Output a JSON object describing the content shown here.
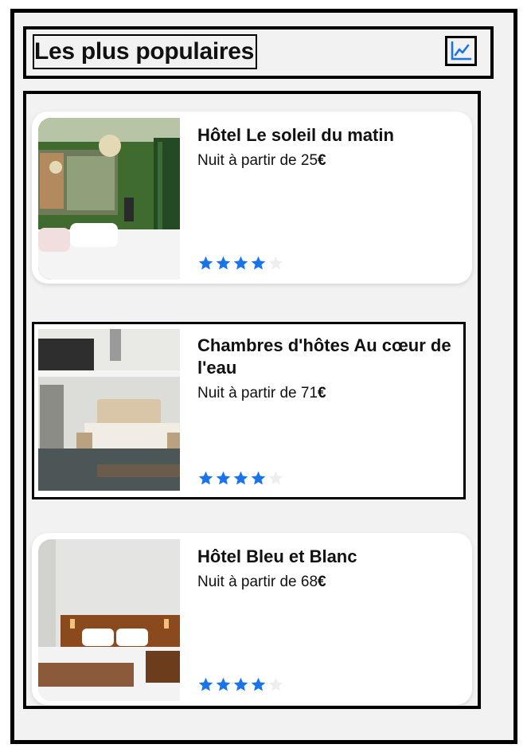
{
  "header": {
    "title": "Les plus populaires",
    "chart_icon": "chart-line-icon"
  },
  "accent_color": "#1a73e8",
  "star_empty_color": "#eeeeee",
  "hotels": [
    {
      "name": "Hôtel Le soleil du matin",
      "price_prefix": "Nuit à partir de ",
      "price_value": "25",
      "currency": "€",
      "rating": 4,
      "rating_max": 5
    },
    {
      "name": "Chambres d'hôtes Au cœur de l'eau",
      "price_prefix": "Nuit à partir de ",
      "price_value": "71",
      "currency": "€",
      "rating": 4,
      "rating_max": 5
    },
    {
      "name": "Hôtel Bleu et Blanc",
      "price_prefix": "Nuit à partir de ",
      "price_value": "68",
      "currency": "€",
      "rating": 4,
      "rating_max": 5
    }
  ]
}
